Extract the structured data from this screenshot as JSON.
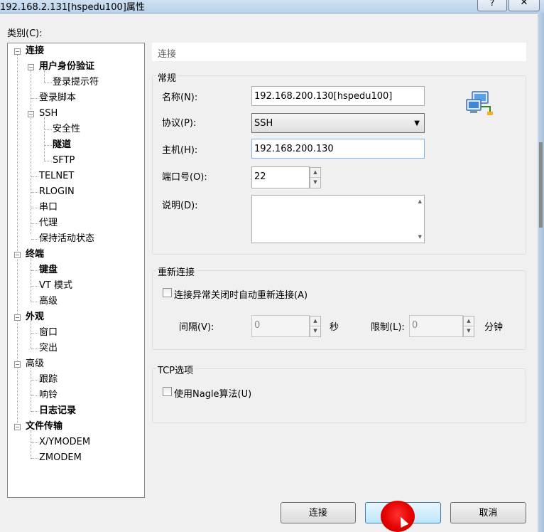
{
  "window": {
    "title": "192.168.2.131[hspedu100]属性",
    "help_label": "?",
    "close_label": "✕"
  },
  "category_label": "类别(C):",
  "tree": {
    "expander_minus": "−",
    "items": [
      {
        "label": "连接"
      },
      {
        "label": "用户身份验证"
      },
      {
        "label": "登录提示符"
      },
      {
        "label": "登录脚本"
      },
      {
        "label": "SSH"
      },
      {
        "label": "安全性"
      },
      {
        "label": "隧道"
      },
      {
        "label": "SFTP"
      },
      {
        "label": "TELNET"
      },
      {
        "label": "RLOGIN"
      },
      {
        "label": "串口"
      },
      {
        "label": "代理"
      },
      {
        "label": "保持活动状态"
      },
      {
        "label": "终端"
      },
      {
        "label": "键盘"
      },
      {
        "label": "VT 模式"
      },
      {
        "label": "高级"
      },
      {
        "label": "外观"
      },
      {
        "label": "窗口"
      },
      {
        "label": "突出"
      },
      {
        "label": "高级"
      },
      {
        "label": "跟踪"
      },
      {
        "label": "响铃"
      },
      {
        "label": "日志记录"
      },
      {
        "label": "文件传输"
      },
      {
        "label": "X/YMODEM"
      },
      {
        "label": "ZMODEM"
      }
    ]
  },
  "panel_header": "连接",
  "general": {
    "title": "常规",
    "name_label": "名称(N):",
    "name_value": "192.168.200.130[hspedu100]",
    "protocol_label": "协议(P):",
    "protocol_value": "SSH",
    "host_label": "主机(H):",
    "host_value": "192.168.200.130",
    "port_label": "端口号(O):",
    "port_value": "22",
    "desc_label": "说明(D):",
    "desc_value": ""
  },
  "reconnect": {
    "title": "重新连接",
    "checkbox_label": "连接异常关闭时自动重新连接(A)",
    "checked": false,
    "interval_label": "间隔(V):",
    "interval_value": "0",
    "interval_unit": "秒",
    "limit_label": "限制(L):",
    "limit_value": "0",
    "limit_unit": "分钟"
  },
  "tcp": {
    "title": "TCP选项",
    "checkbox_label": "使用Nagle算法(U)",
    "checked": false
  },
  "buttons": {
    "connect": "连接",
    "ok": "",
    "cancel": "取消"
  },
  "icons": {
    "spin_up": "▲",
    "spin_down": "▼",
    "dropdown": "▼"
  }
}
